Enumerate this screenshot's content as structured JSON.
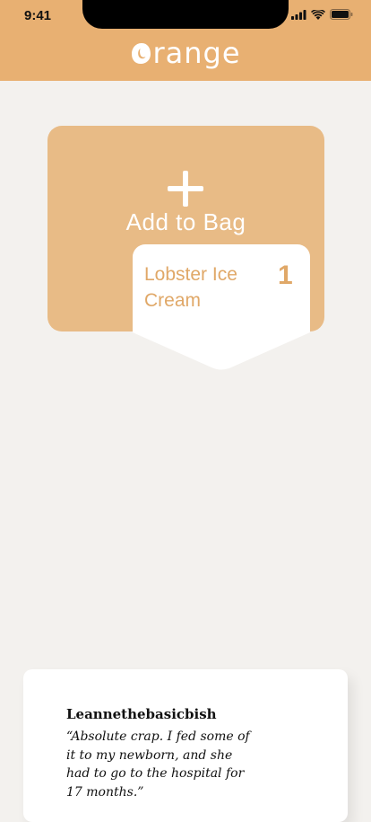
{
  "status_bar": {
    "time": "9:41",
    "icons": [
      "signal-icon",
      "wifi-icon",
      "battery-icon"
    ]
  },
  "header": {
    "logo_text": "range",
    "brand_color": "#e8b072"
  },
  "add_to_bag": {
    "label": "Add to Bag",
    "icon": "plus-icon",
    "card_color": "#e8bb86"
  },
  "bag_item": {
    "name": "Lobster Ice Cream",
    "quantity": "1",
    "text_color": "#e0a868"
  },
  "review": {
    "author": "Leannethebasicbish",
    "quote": "“Absolute crap. I fed some of it to my newborn, and she had to go to the hospital for 17 months.”"
  }
}
